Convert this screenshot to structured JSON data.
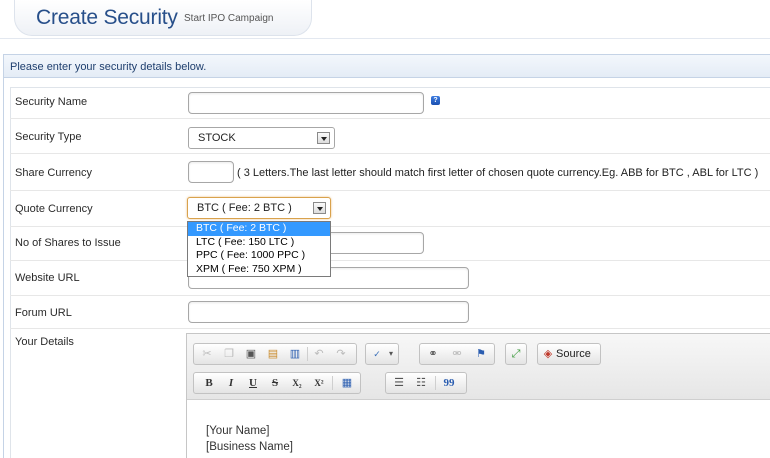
{
  "header": {
    "title": "Create Security",
    "subtitle": "Start IPO Campaign"
  },
  "instruction": "Please enter your security details below.",
  "fields": {
    "security_name": {
      "label": "Security Name",
      "value": ""
    },
    "security_type": {
      "label": "Security Type",
      "value": "STOCK"
    },
    "share_currency": {
      "label": "Share Currency",
      "value": "",
      "hint": "( 3 Letters.The last letter should match first letter of chosen quote currency.Eg. ABB for BTC , ABL for LTC )"
    },
    "quote_currency": {
      "label": "Quote Currency",
      "value": "BTC ( Fee: 2 BTC )",
      "options": [
        "BTC ( Fee: 2 BTC )",
        "LTC ( Fee: 150 LTC )",
        "PPC ( Fee: 1000 PPC )",
        "XPM ( Fee: 750 XPM )"
      ],
      "selected_index": 0
    },
    "shares_to_issue": {
      "label": "No of Shares to Issue",
      "value": ""
    },
    "website_url": {
      "label": "Website URL",
      "value": ""
    },
    "forum_url": {
      "label": "Forum URL",
      "value": ""
    },
    "your_details": {
      "label": "Your Details"
    }
  },
  "editor": {
    "source_label": "Source",
    "toolbar_row1": [
      "cut-icon",
      "copy-icon",
      "paste-icon",
      "paste-text-icon",
      "paste-word-icon",
      "undo-icon",
      "redo-icon",
      "spellcheck-icon",
      "link-icon",
      "unlink-icon",
      "anchor-icon",
      "maximize-icon",
      "source-icon"
    ],
    "toolbar_row2": [
      "bold-icon",
      "italic-icon",
      "underline-icon",
      "strike-icon",
      "subscript-icon",
      "superscript-icon",
      "remove-format-icon",
      "numbered-list-icon",
      "bulleted-list-icon",
      "blockquote-icon"
    ],
    "format_labels": {
      "bold": "B",
      "italic": "I",
      "underline": "U",
      "strike": "S",
      "subscript": "X₂",
      "superscript": "X²",
      "blockquote": "99"
    },
    "body_lines": [
      "[Your Name]",
      "[Business Name]"
    ]
  },
  "colors": {
    "title": "#274f8a",
    "instruction_text": "#1f3f6e",
    "dropdown_highlight": "#3399ff",
    "help_icon": "#2a64c8"
  }
}
